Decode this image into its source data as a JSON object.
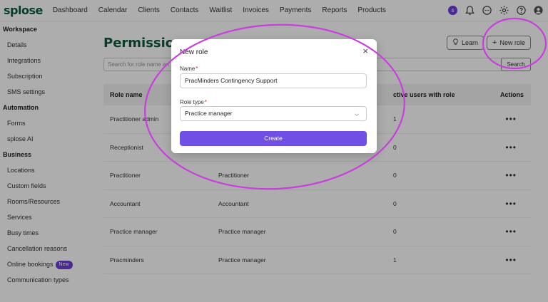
{
  "app": {
    "logo": "splose"
  },
  "nav": {
    "items": [
      "Dashboard",
      "Calendar",
      "Clients",
      "Contacts",
      "Waitlist",
      "Invoices",
      "Payments",
      "Reports",
      "Products"
    ]
  },
  "topbar_icons": [
    "splose-badge-icon",
    "bell-icon",
    "chat-icon",
    "gear-icon",
    "help-icon",
    "user-icon"
  ],
  "sidebar": {
    "workspace": {
      "heading": "Workspace",
      "items": [
        "Details",
        "Integrations",
        "Subscription",
        "SMS settings"
      ]
    },
    "automation": {
      "heading": "Automation",
      "items": [
        "Forms",
        "splose AI"
      ]
    },
    "business": {
      "heading": "Business",
      "items": [
        "Locations",
        "Custom fields",
        "Rooms/Resources",
        "Services",
        "Busy times",
        "Cancellation reasons",
        "Online bookings",
        "Communication types"
      ],
      "badge": "New"
    }
  },
  "page": {
    "title": "Permission",
    "learn_label": "Learn",
    "new_role_label": "New role",
    "search_placeholder": "Search for role name an",
    "search_button": "Search"
  },
  "table": {
    "headers": [
      "Role name",
      "",
      "ctive users with role",
      "Actions"
    ],
    "rows": [
      {
        "name": "Practitioner admin",
        "type": "",
        "users": "1"
      },
      {
        "name": "Receptionist",
        "type": "",
        "users": "0"
      },
      {
        "name": "Practitioner",
        "type": "Practitioner",
        "users": "0"
      },
      {
        "name": "Accountant",
        "type": "Accountant",
        "users": "0"
      },
      {
        "name": "Practice manager",
        "type": "Practice manager",
        "users": "0"
      },
      {
        "name": "Pracminders",
        "type": "Practice manager",
        "users": "1"
      }
    ],
    "actions_glyph": "•••"
  },
  "modal": {
    "title": "New role",
    "close_glyph": "×",
    "name_label": "Name",
    "name_value": "PracMinders Contingency Support",
    "role_type_label": "Role type",
    "role_type_value": "Practice manager",
    "required_mark": "*",
    "create_label": "Create"
  },
  "colors": {
    "brand_green": "#0d5a3c",
    "accent_purple": "#6f4fe6",
    "annotation_magenta": "#c83fdd"
  }
}
